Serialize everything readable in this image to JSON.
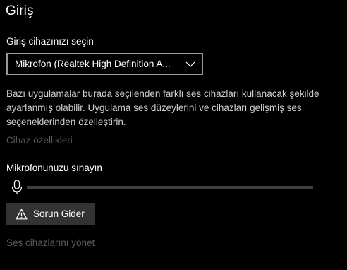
{
  "section": {
    "title": "Giriş"
  },
  "input_device": {
    "label": "Giriş cihazınızı seçin",
    "selected": "Mikrofon (Realtek High Definition A...",
    "icon": "chevron-down-icon"
  },
  "description": "Bazı uygulamalar burada seçilenden farklı ses cihazları kullanacak şekilde ayarlanmış olabilir. Uygulama ses düzeylerini ve cihazları gelişmiş ses seçeneklerinden özelleştirin.",
  "device_properties_link": "Cihaz özellikleri",
  "mic_test": {
    "label": "Mikrofonunuzu sınayın",
    "icon": "microphone-icon",
    "level": 0
  },
  "troubleshoot": {
    "label": "Sorun Gider",
    "icon": "warning-icon"
  },
  "manage_devices_link": "Ses cihazlarını yönet",
  "colors": {
    "background": "#000000",
    "text": "#ffffff",
    "disabled_link": "#5c5c5c",
    "button_bg": "#333333",
    "dropdown_border": "#999999",
    "level_track": "#3f3f3f"
  }
}
